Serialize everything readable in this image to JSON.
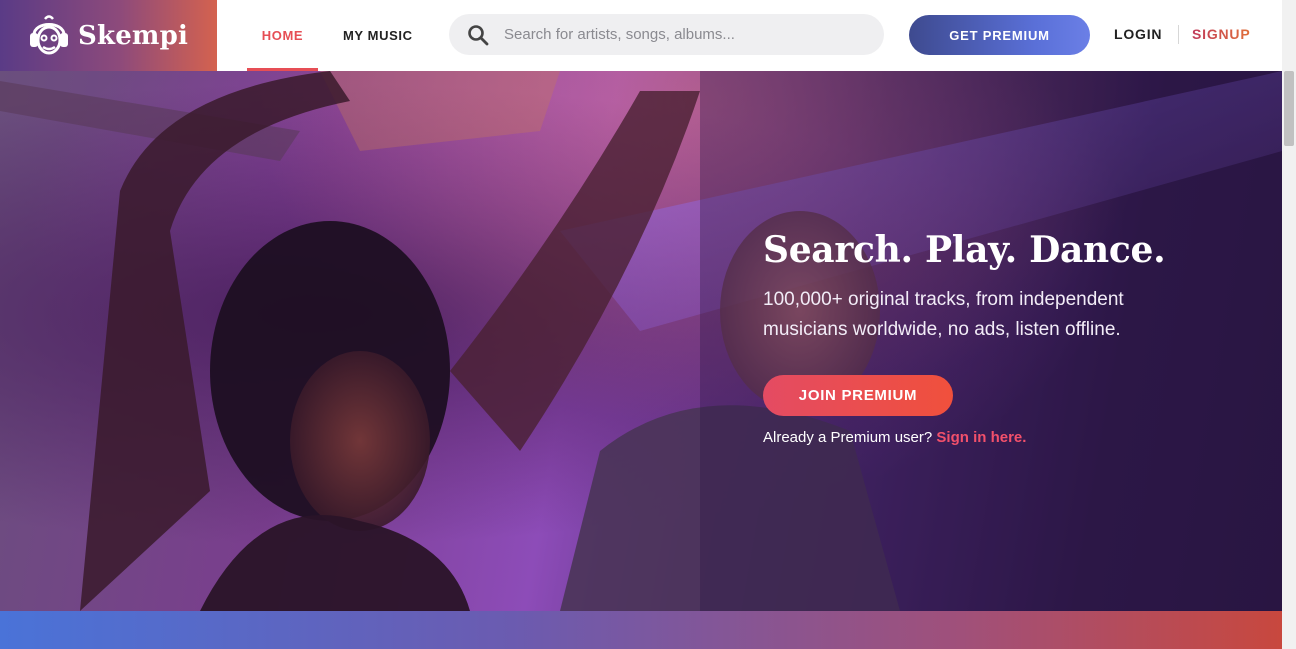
{
  "brand": {
    "name": "Skempi",
    "logo_icon": "headphones-monkey-icon",
    "gradient": [
      "#5a3b86",
      "#d4624f"
    ]
  },
  "nav": {
    "home": "HOME",
    "my_music": "MY MUSIC"
  },
  "search": {
    "placeholder": "Search for artists, songs, albums...",
    "value": "",
    "icon": "search-icon"
  },
  "header_actions": {
    "get_premium": "GET PREMIUM",
    "login": "LOGIN",
    "signup": "SIGNUP"
  },
  "hero": {
    "title": "Search. Play. Dance.",
    "subtitle": "100,000+ original tracks, from independent musicians worldwide, no ads, listen offline.",
    "cta": "JOIN PREMIUM",
    "already_text": "Already a Premium user?",
    "signin_link": "Sign in here."
  },
  "colors": {
    "accent": "#e64e55",
    "premium_button": "#4b5bc0",
    "join_button": "#ec4d50",
    "link": "#f2506b"
  }
}
